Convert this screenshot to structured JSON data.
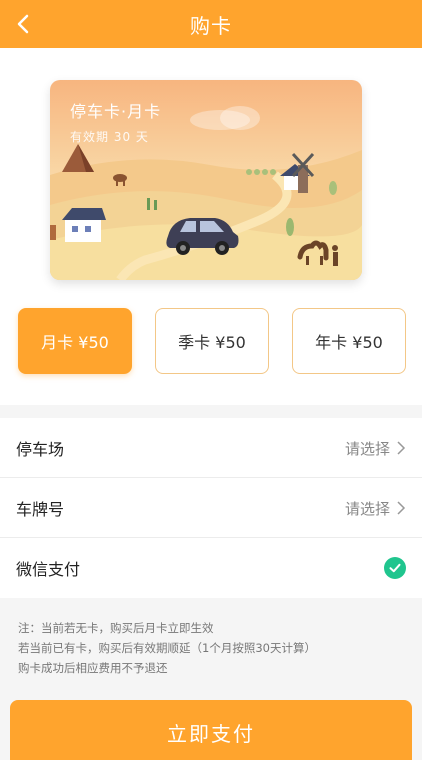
{
  "header": {
    "title": "购卡"
  },
  "card": {
    "title": "停车卡·月卡",
    "subtitle": "有效期 30 天"
  },
  "options": [
    {
      "label": "月卡 ¥50",
      "selected": true
    },
    {
      "label": "季卡 ¥50",
      "selected": false
    },
    {
      "label": "年卡 ¥50",
      "selected": false
    }
  ],
  "list": {
    "parking": {
      "label": "停车场",
      "value": "请选择"
    },
    "plate": {
      "label": "车牌号",
      "value": "请选择"
    },
    "wechat": {
      "label": "微信支付",
      "checked": true
    }
  },
  "notes": [
    "注：当前若无卡，购买后月卡立即生效",
    "若当前已有卡，购买后有效期顺延（1个月按照30天计算）",
    "购卡成功后相应费用不予退还"
  ],
  "pay_button": {
    "label": "立即支付"
  },
  "colors": {
    "accent": "#ffa42d",
    "check": "#20c58e"
  }
}
